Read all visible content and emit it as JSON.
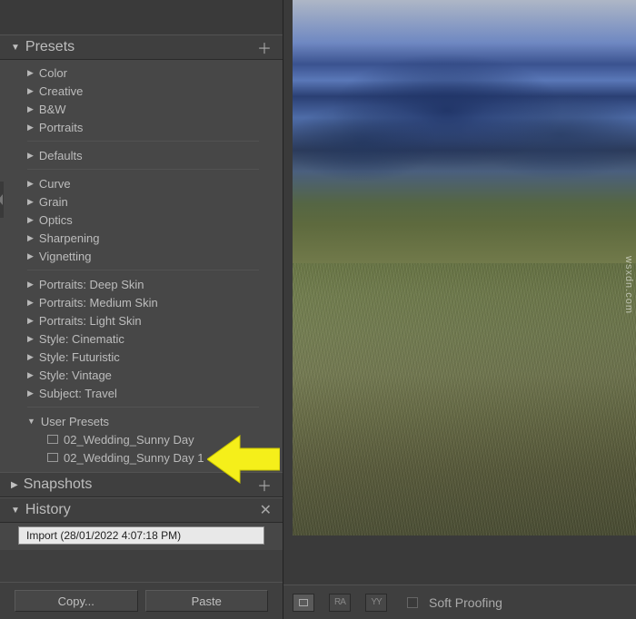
{
  "panels": {
    "presets": {
      "title": "Presets",
      "groups1": [
        "Color",
        "Creative",
        "B&W",
        "Portraits"
      ],
      "groups2": [
        "Defaults"
      ],
      "groups3": [
        "Curve",
        "Grain",
        "Optics",
        "Sharpening",
        "Vignetting"
      ],
      "groups4": [
        "Portraits: Deep Skin",
        "Portraits: Medium Skin",
        "Portraits: Light Skin",
        "Style: Cinematic",
        "Style: Futuristic",
        "Style: Vintage",
        "Subject: Travel"
      ],
      "user_folder": "User Presets",
      "user_items": [
        "02_Wedding_Sunny Day",
        "02_Wedding_Sunny Day 1"
      ]
    },
    "snapshots": {
      "title": "Snapshots"
    },
    "history": {
      "title": "History",
      "entry": "Import (28/01/2022 4:07:18 PM)"
    }
  },
  "buttons": {
    "copy": "Copy...",
    "paste": "Paste"
  },
  "toolbar": {
    "soft_proofing": "Soft Proofing"
  },
  "watermark": "wsxdn.com"
}
